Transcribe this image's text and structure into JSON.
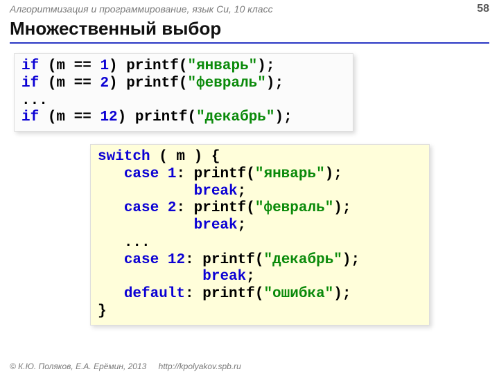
{
  "header": {
    "course": "Алгоритмизация и программирование, язык Си, 10 класс",
    "page": "58"
  },
  "title": "Множественный выбор",
  "box1": {
    "l1_if": "if",
    "l1_a": " (m == ",
    "l1_n": "1",
    "l1_b": ") printf(",
    "l1_s": "\"январь\"",
    "l1_c": ");",
    "l2_if": "if",
    "l2_a": " (m == ",
    "l2_n": "2",
    "l2_b": ") printf(",
    "l2_s": "\"февраль\"",
    "l2_c": ");",
    "l3": "...",
    "l4_if": "if",
    "l4_a": " (m == ",
    "l4_n": "12",
    "l4_b": ") printf(",
    "l4_s": "\"декабрь\"",
    "l4_c": ");"
  },
  "box2": {
    "l1_sw": "switch",
    "l1_a": " ( m ) { ",
    "l2_ind": "   ",
    "l2_case": "case",
    "l2_a": " ",
    "l2_n": "1",
    "l2_b": ": printf(",
    "l2_s": "\"январь\"",
    "l2_c": ");",
    "l3_ind": "           ",
    "l3_break": "break",
    "l3_a": ";",
    "l4_ind": "   ",
    "l4_case": "case",
    "l4_a": " ",
    "l4_n": "2",
    "l4_b": ": printf(",
    "l4_s": "\"февраль\"",
    "l4_c": ");",
    "l5_ind": "           ",
    "l5_break": "break",
    "l5_a": ";",
    "l6_ind": "   ",
    "l6": "...",
    "l7_ind": "   ",
    "l7_case": "case",
    "l7_a": " ",
    "l7_n": "12",
    "l7_b": ": printf(",
    "l7_s": "\"декабрь\"",
    "l7_c": ");",
    "l8_ind": "            ",
    "l8_break": "break",
    "l8_a": ";",
    "l9_ind": "   ",
    "l9_def": "default",
    "l9_a": ": printf(",
    "l9_s": "\"ошибка\"",
    "l9_b": ");",
    "l10": "}"
  },
  "footer": {
    "copyright": "© К.Ю. Поляков, Е.А. Ерёмин, 2013",
    "url": "http://kpolyakov.spb.ru"
  }
}
